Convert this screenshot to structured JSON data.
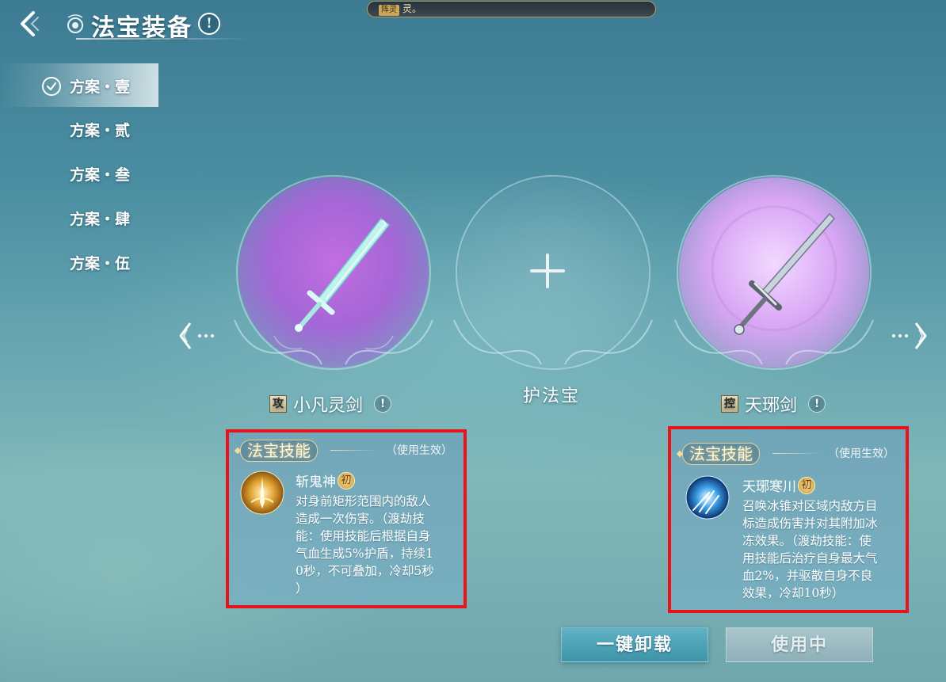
{
  "header": {
    "title": "法宝装备",
    "info_icon": "!",
    "notice_tag": "阵灵",
    "notice_text": "灵。"
  },
  "schemes": [
    {
      "label": "方案・壹",
      "active": true
    },
    {
      "label": "方案・贰",
      "active": false
    },
    {
      "label": "方案・叁",
      "active": false
    },
    {
      "label": "方案・肆",
      "active": false
    },
    {
      "label": "方案・伍",
      "active": false
    }
  ],
  "slots": {
    "left": {
      "type_badge": "攻",
      "name": "小凡灵剑",
      "info_icon": "!",
      "art": "sword-icon"
    },
    "center": {
      "name": "护法宝",
      "icon": "plus-icon"
    },
    "right": {
      "type_badge": "控",
      "name": "天琊剑",
      "info_icon": "!",
      "art": "sword-icon"
    }
  },
  "skill_panels": {
    "left": {
      "header": "法宝技能",
      "note": "（使用生效）",
      "skill_name": "斩鬼神",
      "tier": "初",
      "desc_lines": [
        "对身前矩形范围内的敌人",
        "造成一次伤害。（渡劫技",
        "能：使用技能后根据自身",
        "气血生成5%护盾，持续1",
        "0秒，不可叠加，冷却5秒",
        "）"
      ]
    },
    "right": {
      "header": "法宝技能",
      "note": "（使用生效）",
      "skill_name": "天琊寒川",
      "tier": "初",
      "desc_lines": [
        "召唤冰锥对区域内敌方目",
        "标造成伤害并对其附加冰",
        "冻效果。（渡劫技能：使",
        "用技能后治疗自身最大气",
        "血2%，并驱散自身不良",
        "效果，冷却10秒）"
      ]
    }
  },
  "buttons": {
    "unload": "一键卸载",
    "in_use": "使用中"
  },
  "colors": {
    "highlight_border": "#e8141c",
    "left_glow": "#a466d6",
    "right_glow": "#d9a6f5",
    "unload_button": "#3e93a8"
  }
}
